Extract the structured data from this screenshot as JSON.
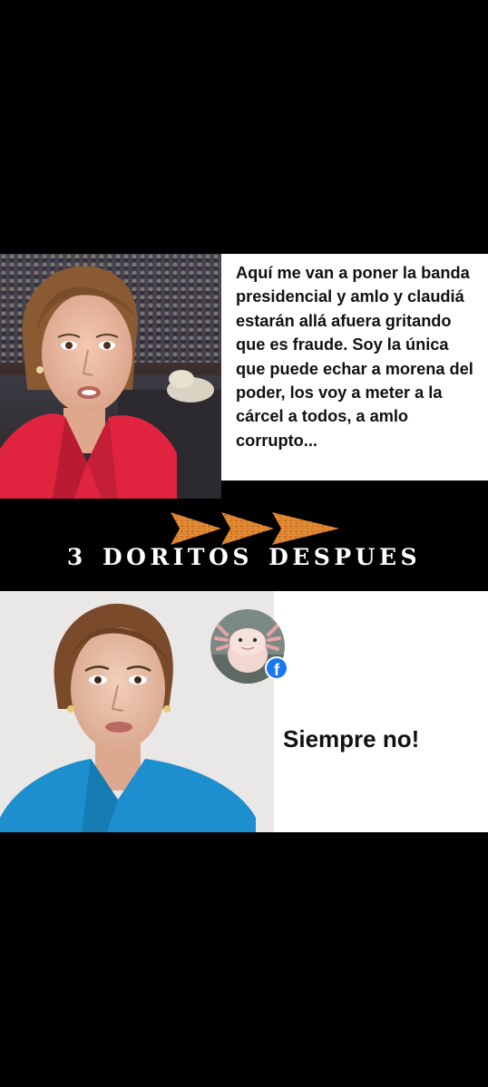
{
  "top_panel": {
    "quote": "Aquí me van a poner la banda presidencial y amlo y claudiá estarán allá afuera gritando que es fraude. Soy la única que puede echar a morena del poder, los voy a meter a la cárcel a todos, a amlo corrupto..."
  },
  "band": {
    "caption": "3 DORITOS DESPUES",
    "arrow_icon": "dorito-arrow-icon",
    "arrow_count": 3
  },
  "bottom_panel": {
    "reply": "Siempre no!",
    "badge_icon": "facebook-icon",
    "badge_glyph": "f"
  },
  "colors": {
    "background": "#000000",
    "panel": "#ffffff",
    "dorito": "#e8892a",
    "jacket_red": "#e0243f",
    "blouse_blue": "#1d8fce",
    "facebook": "#1877f2"
  }
}
